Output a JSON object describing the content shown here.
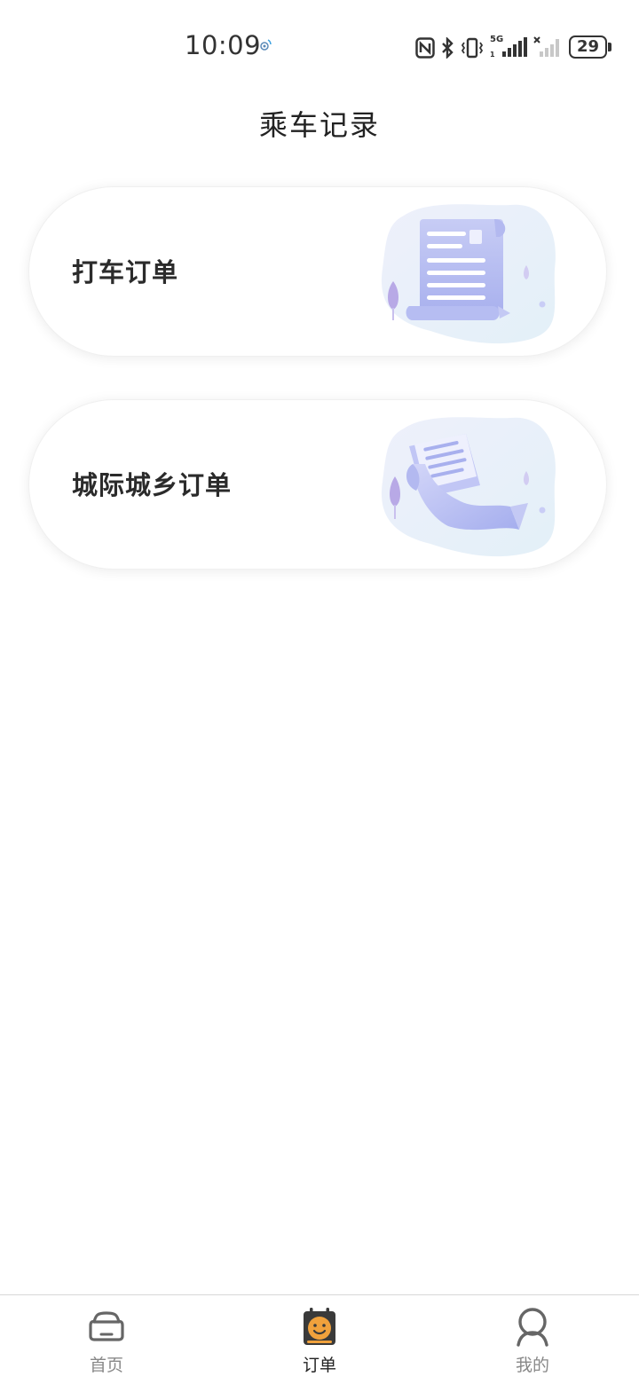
{
  "status_bar": {
    "time": "10:09",
    "network": "5G",
    "battery": "29"
  },
  "header": {
    "title": "乘车记录"
  },
  "cards": [
    {
      "label": "打车订单",
      "icon": "document-illustration"
    },
    {
      "label": "城际城乡订单",
      "icon": "scroll-illustration"
    }
  ],
  "bottom_nav": {
    "items": [
      {
        "label": "首页",
        "icon": "car-icon",
        "active": false
      },
      {
        "label": "订单",
        "icon": "order-icon",
        "active": true
      },
      {
        "label": "我的",
        "icon": "person-icon",
        "active": false
      }
    ]
  },
  "colors": {
    "accent_orange": "#f0a13c",
    "illustration_purple": "#c9cdf6",
    "nav_inactive": "#888888"
  }
}
